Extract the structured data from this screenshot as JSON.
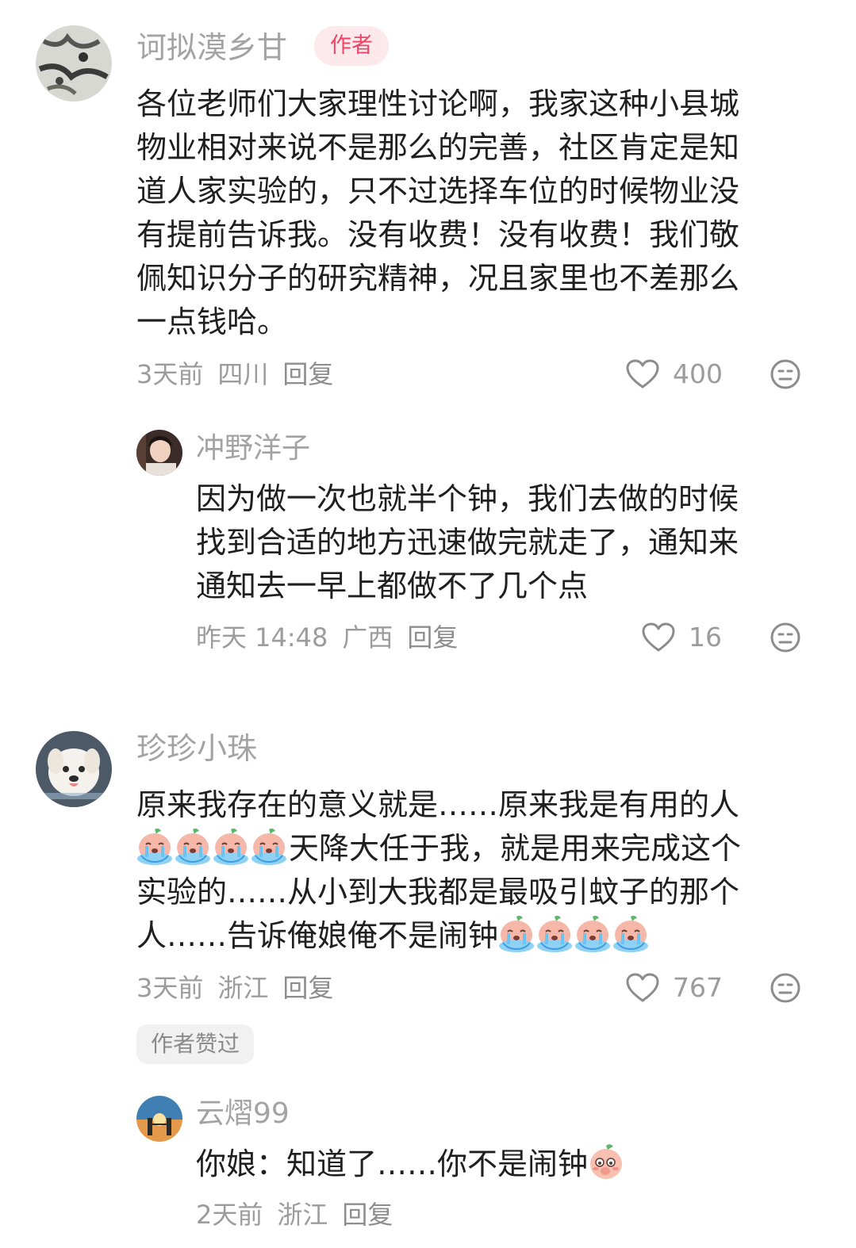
{
  "comments": [
    {
      "user": "诃拟漠乡甘",
      "author_badge": "作者",
      "lines": [
        "各位老师们大家理性讨论啊，我家这种小县城",
        "物业相对来说不是那么的完善，社区肯定是知",
        "道人家实验的，只不过选择车位的时候物业没",
        "有提前告诉我。没有收费！没有收费！我们敬",
        "佩知识分子的研究精神，况且家里也不差那么",
        "一点钱哈。"
      ],
      "time": "3天前",
      "location": "四川",
      "reply": "回复",
      "likes": "400",
      "replies": [
        {
          "user": "冲野洋子",
          "lines": [
            "因为做一次也就半个钟，我们去做的时候",
            "找到合适的地方迅速做完就走了，通知来",
            "通知去一早上都做不了几个点"
          ],
          "time": "昨天 14:48",
          "location": "广西",
          "reply": "回复",
          "likes": "16"
        }
      ]
    },
    {
      "user": "珍珍小珠",
      "lines": [
        "原来我存在的意义就是……原来我是有用的人",
        "天降大任于我，就是用来完成这个",
        "实验的……从小到大我都是最吸引蚊子的那个",
        "人……告诉俺娘俺不是闹钟"
      ],
      "time": "3天前",
      "location": "浙江",
      "reply": "回复",
      "likes": "767",
      "liked_by_author": "作者赞过",
      "replies": [
        {
          "user": "云熠99",
          "lines": [
            "你娘：知道了……你不是闹钟"
          ],
          "time": "2天前",
          "location": "浙江",
          "reply": "回复"
        }
      ]
    }
  ],
  "icons": {
    "like": "heart-outline-icon",
    "dislike": "neutral-face-icon",
    "crying_emoji": "crying-peach-emoji",
    "shy_emoji": "shy-peach-emoji"
  },
  "colors": {
    "author_badge_bg": "#fde9ec",
    "author_badge_text": "#ef4466",
    "username": "#a3a3a3",
    "meta": "#9c9c9c",
    "body": "#1f1f1f"
  }
}
